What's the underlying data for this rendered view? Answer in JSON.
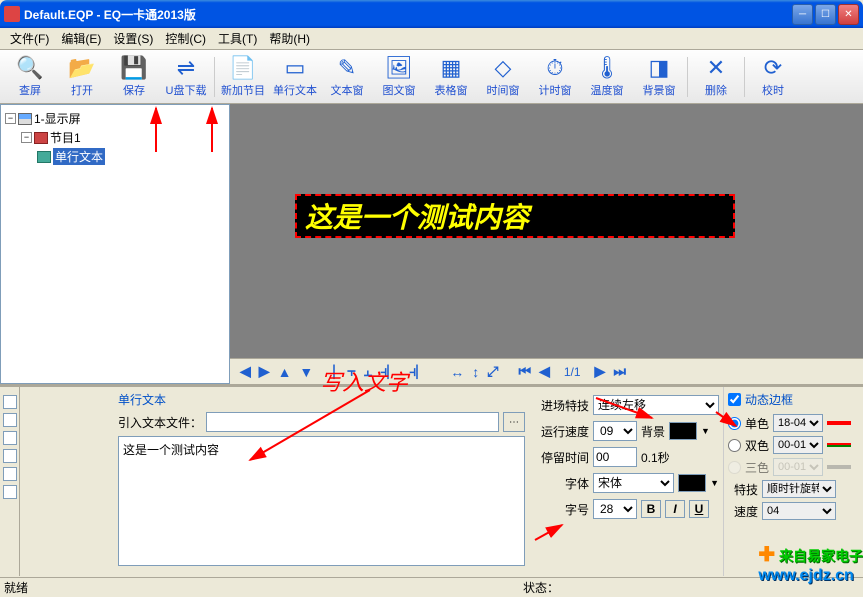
{
  "title": "Default.EQP - EQ一卡通2013版",
  "menu": [
    "文件(F)",
    "编辑(E)",
    "设置(S)",
    "控制(C)",
    "工具(T)",
    "帮助(H)"
  ],
  "toolbar": [
    {
      "icon": "🔍",
      "label": "查屏"
    },
    {
      "icon": "📂",
      "label": "打开"
    },
    {
      "icon": "💾",
      "label": "保存"
    },
    {
      "icon": "⇌",
      "label": "U盘下载"
    },
    {
      "sep": true
    },
    {
      "icon": "📄",
      "label": "新加节目"
    },
    {
      "icon": "▭",
      "label": "单行文本"
    },
    {
      "icon": "✎",
      "label": "文本窗"
    },
    {
      "icon": "🖼",
      "label": "图文窗"
    },
    {
      "icon": "▦",
      "label": "表格窗"
    },
    {
      "icon": "◇",
      "label": "时间窗"
    },
    {
      "icon": "⏱",
      "label": "计时窗"
    },
    {
      "icon": "🌡",
      "label": "温度窗"
    },
    {
      "icon": "◨",
      "label": "背景窗"
    },
    {
      "sep": true
    },
    {
      "icon": "✕",
      "label": "删除"
    },
    {
      "sep": true
    },
    {
      "icon": "⟳",
      "label": "校时"
    }
  ],
  "tree": {
    "root": "1-显示屏",
    "prog": "节目1",
    "item": "单行文本"
  },
  "preview_text": "这是一个测试内容",
  "page_indicator": "1/1",
  "text_panel": {
    "header": "单行文本",
    "import_label": "引入文本文件：",
    "content": "这是一个测试内容"
  },
  "anim": {
    "effect_label": "进场特技",
    "effect": "连续左移",
    "speed_label": "运行速度",
    "speed": "09",
    "bg_label": "背景",
    "stay_label": "停留时间",
    "stay": "00",
    "stay_unit": "0.1秒",
    "font_label": "字体",
    "font": "宋体",
    "size_label": "字号",
    "size": "28"
  },
  "border": {
    "dynamic": "动态边框",
    "single": "单色",
    "single_val": "18-04",
    "double": "双色",
    "double_val": "00-01",
    "triple": "三色",
    "triple_val": "00-01",
    "effect": "特技",
    "effect_val": "顺时针旋转",
    "speed": "速度",
    "speed_val": "04"
  },
  "annotation": "写入文字",
  "status": {
    "ready": "就绪",
    "state": "状态："
  },
  "watermark": {
    "l1": "来自易家电子",
    "l2": "www.ejdz.cn"
  }
}
